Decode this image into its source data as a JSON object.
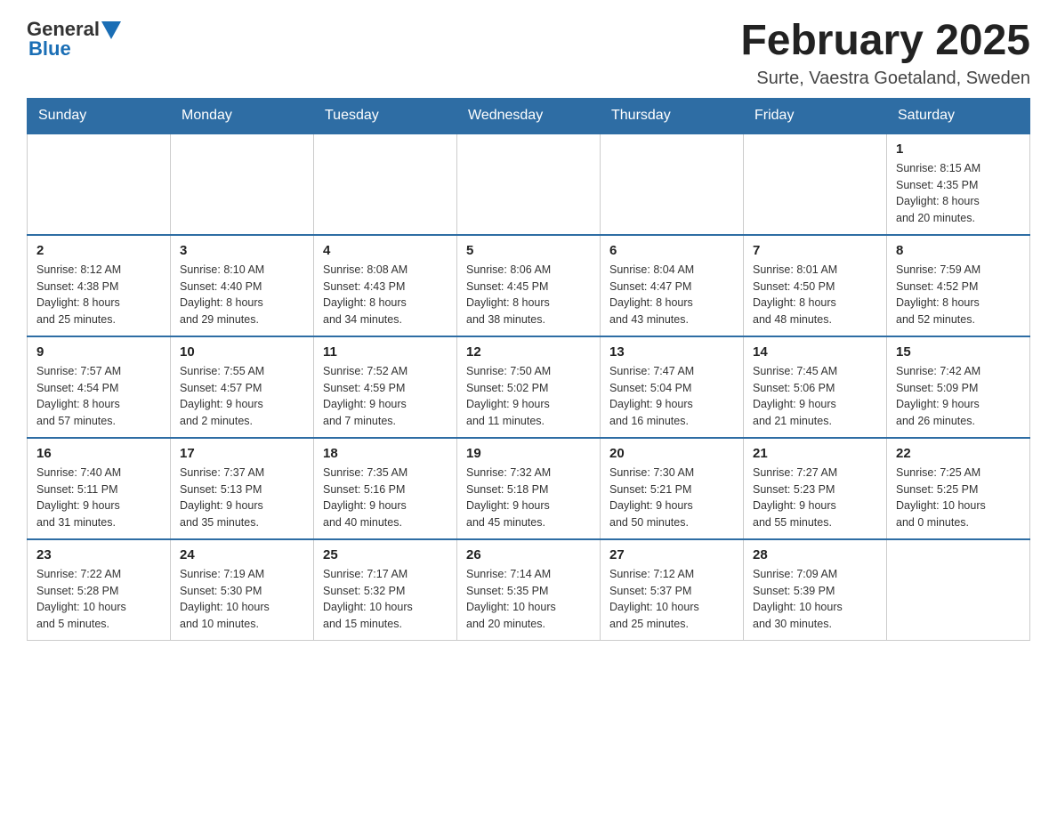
{
  "header": {
    "logo_general": "General",
    "logo_blue": "Blue",
    "month_title": "February 2025",
    "location": "Surte, Vaestra Goetaland, Sweden"
  },
  "weekdays": [
    "Sunday",
    "Monday",
    "Tuesday",
    "Wednesday",
    "Thursday",
    "Friday",
    "Saturday"
  ],
  "weeks": [
    {
      "days": [
        {
          "number": "",
          "info": ""
        },
        {
          "number": "",
          "info": ""
        },
        {
          "number": "",
          "info": ""
        },
        {
          "number": "",
          "info": ""
        },
        {
          "number": "",
          "info": ""
        },
        {
          "number": "",
          "info": ""
        },
        {
          "number": "1",
          "info": "Sunrise: 8:15 AM\nSunset: 4:35 PM\nDaylight: 8 hours\nand 20 minutes."
        }
      ]
    },
    {
      "days": [
        {
          "number": "2",
          "info": "Sunrise: 8:12 AM\nSunset: 4:38 PM\nDaylight: 8 hours\nand 25 minutes."
        },
        {
          "number": "3",
          "info": "Sunrise: 8:10 AM\nSunset: 4:40 PM\nDaylight: 8 hours\nand 29 minutes."
        },
        {
          "number": "4",
          "info": "Sunrise: 8:08 AM\nSunset: 4:43 PM\nDaylight: 8 hours\nand 34 minutes."
        },
        {
          "number": "5",
          "info": "Sunrise: 8:06 AM\nSunset: 4:45 PM\nDaylight: 8 hours\nand 38 minutes."
        },
        {
          "number": "6",
          "info": "Sunrise: 8:04 AM\nSunset: 4:47 PM\nDaylight: 8 hours\nand 43 minutes."
        },
        {
          "number": "7",
          "info": "Sunrise: 8:01 AM\nSunset: 4:50 PM\nDaylight: 8 hours\nand 48 minutes."
        },
        {
          "number": "8",
          "info": "Sunrise: 7:59 AM\nSunset: 4:52 PM\nDaylight: 8 hours\nand 52 minutes."
        }
      ]
    },
    {
      "days": [
        {
          "number": "9",
          "info": "Sunrise: 7:57 AM\nSunset: 4:54 PM\nDaylight: 8 hours\nand 57 minutes."
        },
        {
          "number": "10",
          "info": "Sunrise: 7:55 AM\nSunset: 4:57 PM\nDaylight: 9 hours\nand 2 minutes."
        },
        {
          "number": "11",
          "info": "Sunrise: 7:52 AM\nSunset: 4:59 PM\nDaylight: 9 hours\nand 7 minutes."
        },
        {
          "number": "12",
          "info": "Sunrise: 7:50 AM\nSunset: 5:02 PM\nDaylight: 9 hours\nand 11 minutes."
        },
        {
          "number": "13",
          "info": "Sunrise: 7:47 AM\nSunset: 5:04 PM\nDaylight: 9 hours\nand 16 minutes."
        },
        {
          "number": "14",
          "info": "Sunrise: 7:45 AM\nSunset: 5:06 PM\nDaylight: 9 hours\nand 21 minutes."
        },
        {
          "number": "15",
          "info": "Sunrise: 7:42 AM\nSunset: 5:09 PM\nDaylight: 9 hours\nand 26 minutes."
        }
      ]
    },
    {
      "days": [
        {
          "number": "16",
          "info": "Sunrise: 7:40 AM\nSunset: 5:11 PM\nDaylight: 9 hours\nand 31 minutes."
        },
        {
          "number": "17",
          "info": "Sunrise: 7:37 AM\nSunset: 5:13 PM\nDaylight: 9 hours\nand 35 minutes."
        },
        {
          "number": "18",
          "info": "Sunrise: 7:35 AM\nSunset: 5:16 PM\nDaylight: 9 hours\nand 40 minutes."
        },
        {
          "number": "19",
          "info": "Sunrise: 7:32 AM\nSunset: 5:18 PM\nDaylight: 9 hours\nand 45 minutes."
        },
        {
          "number": "20",
          "info": "Sunrise: 7:30 AM\nSunset: 5:21 PM\nDaylight: 9 hours\nand 50 minutes."
        },
        {
          "number": "21",
          "info": "Sunrise: 7:27 AM\nSunset: 5:23 PM\nDaylight: 9 hours\nand 55 minutes."
        },
        {
          "number": "22",
          "info": "Sunrise: 7:25 AM\nSunset: 5:25 PM\nDaylight: 10 hours\nand 0 minutes."
        }
      ]
    },
    {
      "days": [
        {
          "number": "23",
          "info": "Sunrise: 7:22 AM\nSunset: 5:28 PM\nDaylight: 10 hours\nand 5 minutes."
        },
        {
          "number": "24",
          "info": "Sunrise: 7:19 AM\nSunset: 5:30 PM\nDaylight: 10 hours\nand 10 minutes."
        },
        {
          "number": "25",
          "info": "Sunrise: 7:17 AM\nSunset: 5:32 PM\nDaylight: 10 hours\nand 15 minutes."
        },
        {
          "number": "26",
          "info": "Sunrise: 7:14 AM\nSunset: 5:35 PM\nDaylight: 10 hours\nand 20 minutes."
        },
        {
          "number": "27",
          "info": "Sunrise: 7:12 AM\nSunset: 5:37 PM\nDaylight: 10 hours\nand 25 minutes."
        },
        {
          "number": "28",
          "info": "Sunrise: 7:09 AM\nSunset: 5:39 PM\nDaylight: 10 hours\nand 30 minutes."
        },
        {
          "number": "",
          "info": ""
        }
      ]
    }
  ]
}
